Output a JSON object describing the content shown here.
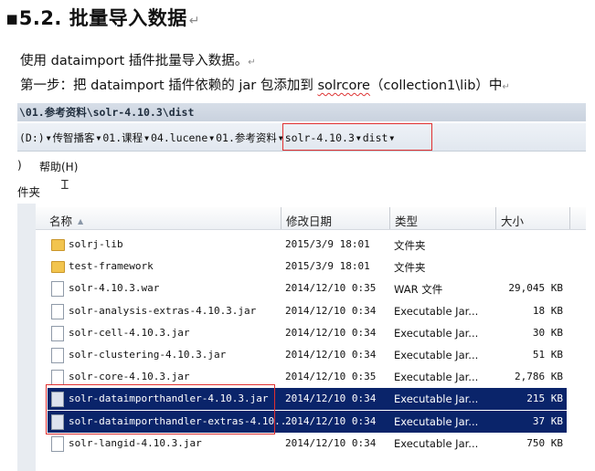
{
  "doc": {
    "heading": "5.2. 批量导入数据",
    "para1": "使用 dataimport 插件批量导入数据。",
    "para2_prefix": "第一步：把 dataimport 插件依赖的 jar 包添加到 ",
    "para2_spell": "solrcore",
    "para2_suffix": "（collection1\\lib）中",
    "para_mark": "↵"
  },
  "explorer": {
    "title_path": "\\01.参考资料\\solr-4.10.3\\dist",
    "breadcrumbs": [
      "(D:)",
      "传智播客",
      "01.课程",
      "04.lucene",
      "01.参考资料",
      "solr-4.10.3",
      "dist"
    ],
    "menu_paren": ")",
    "menu_help": "帮助(H)",
    "toolbar_text": "件夹",
    "columns": {
      "name": "名称",
      "date": "修改日期",
      "type": "类型",
      "size": "大小"
    },
    "files": [
      {
        "name": "solrj-lib",
        "date": "2015/3/9 18:01",
        "type": "文件夹",
        "size": "",
        "kind": "folder",
        "selected": false
      },
      {
        "name": "test-framework",
        "date": "2015/3/9 18:01",
        "type": "文件夹",
        "size": "",
        "kind": "folder",
        "selected": false
      },
      {
        "name": "solr-4.10.3.war",
        "date": "2014/12/10 0:35",
        "type": "WAR 文件",
        "size": "29,045 KB",
        "kind": "file",
        "selected": false
      },
      {
        "name": "solr-analysis-extras-4.10.3.jar",
        "date": "2014/12/10 0:34",
        "type": "Executable Jar...",
        "size": "18 KB",
        "kind": "file",
        "selected": false
      },
      {
        "name": "solr-cell-4.10.3.jar",
        "date": "2014/12/10 0:34",
        "type": "Executable Jar...",
        "size": "30 KB",
        "kind": "file",
        "selected": false
      },
      {
        "name": "solr-clustering-4.10.3.jar",
        "date": "2014/12/10 0:34",
        "type": "Executable Jar...",
        "size": "51 KB",
        "kind": "file",
        "selected": false
      },
      {
        "name": "solr-core-4.10.3.jar",
        "date": "2014/12/10 0:35",
        "type": "Executable Jar...",
        "size": "2,786 KB",
        "kind": "file",
        "selected": false
      },
      {
        "name": "solr-dataimporthandler-4.10.3.jar",
        "date": "2014/12/10 0:34",
        "type": "Executable Jar...",
        "size": "215 KB",
        "kind": "file",
        "selected": true
      },
      {
        "name": "solr-dataimporthandler-extras-4.10...",
        "date": "2014/12/10 0:34",
        "type": "Executable Jar...",
        "size": "37 KB",
        "kind": "file",
        "selected": true
      },
      {
        "name": "solr-langid-4.10.3.jar",
        "date": "2014/12/10 0:34",
        "type": "Executable Jar...",
        "size": "750 KB",
        "kind": "file",
        "selected": false
      }
    ],
    "colors": {
      "selection": "#0a246a",
      "highlight_box": "#e03030"
    }
  }
}
